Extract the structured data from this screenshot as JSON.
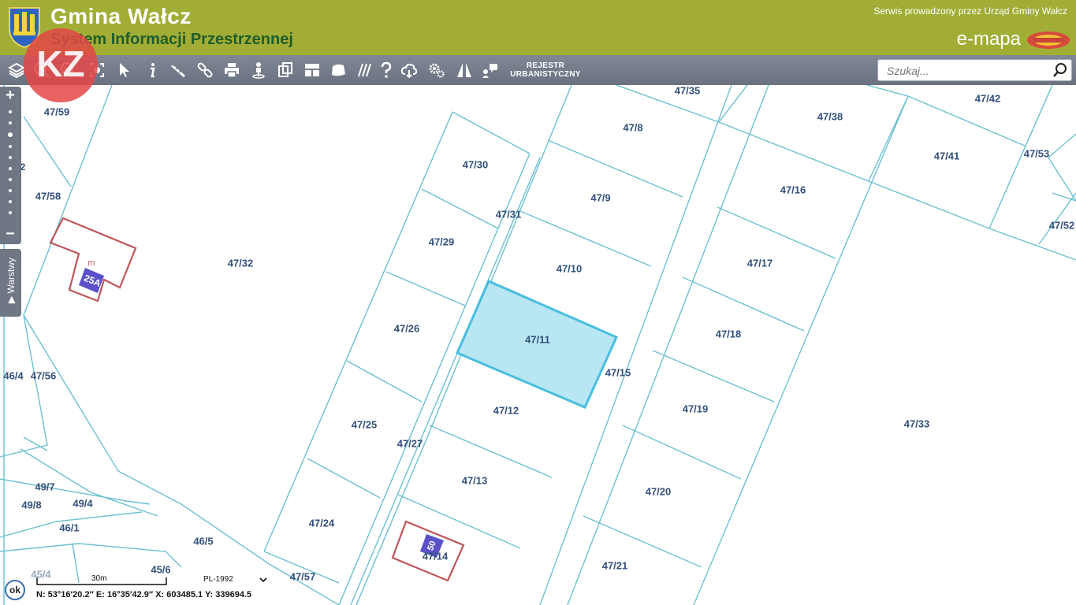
{
  "header": {
    "title": "Gmina Wałcz",
    "subtitle": "System Informacji Przestrzennej",
    "service_text": "Serwis prowadzony przez Urząd Gminy Wałcz",
    "brand": "e-mapa",
    "crest_icon": "coat-of-arms-icon",
    "brand_logo": "geo-system-logo",
    "color": "#a2ad36"
  },
  "toolbar": {
    "icons": [
      "layers-icon",
      "zoom-in-icon",
      "zoom-out-icon",
      "zoom-extent-icon",
      "pointer-icon",
      "info-icon",
      "measure-icon",
      "link-icon",
      "print-icon",
      "street-view-icon",
      "copy-icon",
      "layout-icon",
      "shape-icon",
      "hatch-icon",
      "help-icon",
      "cloud-icon",
      "settings-icon",
      "road-icon",
      "comment-icon"
    ],
    "rejestr_line1": "REJESTR",
    "rejestr_line2": "URBANISTYCZNY",
    "color": "#747b8a"
  },
  "search": {
    "placeholder": "Szukaj..."
  },
  "sidebar": {
    "layers_label": "Warstwy"
  },
  "watermark": {
    "text": "KZ",
    "color": "#e44646"
  },
  "map": {
    "parcel_line_color": "#6cc0d0",
    "selected_fill": "#b8e6f3",
    "selected_stroke": "#48bede",
    "building_stroke": "#c0555b",
    "parcels": [
      {
        "id": "47/35",
        "label": "47/35"
      },
      {
        "id": "47/42",
        "label": "47/42"
      },
      {
        "id": "47/59",
        "label": "47/59"
      },
      {
        "id": "47/8",
        "label": "47/8"
      },
      {
        "id": "47/38",
        "label": "47/38"
      },
      {
        "id": "47/41",
        "label": "47/41"
      },
      {
        "id": "47/53",
        "label": "47/53"
      },
      {
        "id": "47/30",
        "label": "47/30"
      },
      {
        "id": "47/58",
        "label": "47/58"
      },
      {
        "id": "47/9",
        "label": "47/9"
      },
      {
        "id": "47/16",
        "label": "47/16"
      },
      {
        "id": "47/31",
        "label": "47/31"
      },
      {
        "id": "47/52",
        "label": "47/52"
      },
      {
        "id": "47/29",
        "label": "47/29"
      },
      {
        "id": "47/32",
        "label": "47/32"
      },
      {
        "id": "47/10",
        "label": "47/10"
      },
      {
        "id": "47/17",
        "label": "47/17"
      },
      {
        "id": "47/26",
        "label": "47/26"
      },
      {
        "id": "47/11",
        "label": "47/11"
      },
      {
        "id": "47/18",
        "label": "47/18"
      },
      {
        "id": "47/15",
        "label": "47/15"
      },
      {
        "id": "46/4",
        "label": "46/4"
      },
      {
        "id": "47/56",
        "label": "47/56"
      },
      {
        "id": "47/12",
        "label": "47/12"
      },
      {
        "id": "47/19",
        "label": "47/19"
      },
      {
        "id": "47/25",
        "label": "47/25"
      },
      {
        "id": "47/33",
        "label": "47/33"
      },
      {
        "id": "47/27",
        "label": "47/27"
      },
      {
        "id": "47/13",
        "label": "47/13"
      },
      {
        "id": "47/20",
        "label": "47/20"
      },
      {
        "id": "49/7",
        "label": "49/7"
      },
      {
        "id": "49/4",
        "label": "49/4"
      },
      {
        "id": "49/8",
        "label": "49/8"
      },
      {
        "id": "46/1",
        "label": "46/1"
      },
      {
        "id": "47/24",
        "label": "47/24"
      },
      {
        "id": "46/5",
        "label": "46/5"
      },
      {
        "id": "47/14",
        "label": "47/14"
      },
      {
        "id": "47/21",
        "label": "47/21"
      },
      {
        "id": "45/4",
        "label": "45/4"
      },
      {
        "id": "45/6",
        "label": "45/6"
      },
      {
        "id": "47/57",
        "label": "47/57"
      }
    ],
    "building_marks": [
      {
        "label": "25A",
        "color": "#5a52c8"
      },
      {
        "label": "50",
        "color": "#5a52c8"
      },
      {
        "label": "m",
        "color": "#c0555b"
      },
      {
        "label": "2",
        "color": "#33507a"
      }
    ],
    "selected_parcel": "47/11"
  },
  "footer": {
    "ok_label": "ok",
    "scale_label": "30m",
    "crs": "PL-1992",
    "coords": "N: 53°16′20.2″  E: 16°35′42.9″   X: 603485.1   Y: 339694.5"
  }
}
